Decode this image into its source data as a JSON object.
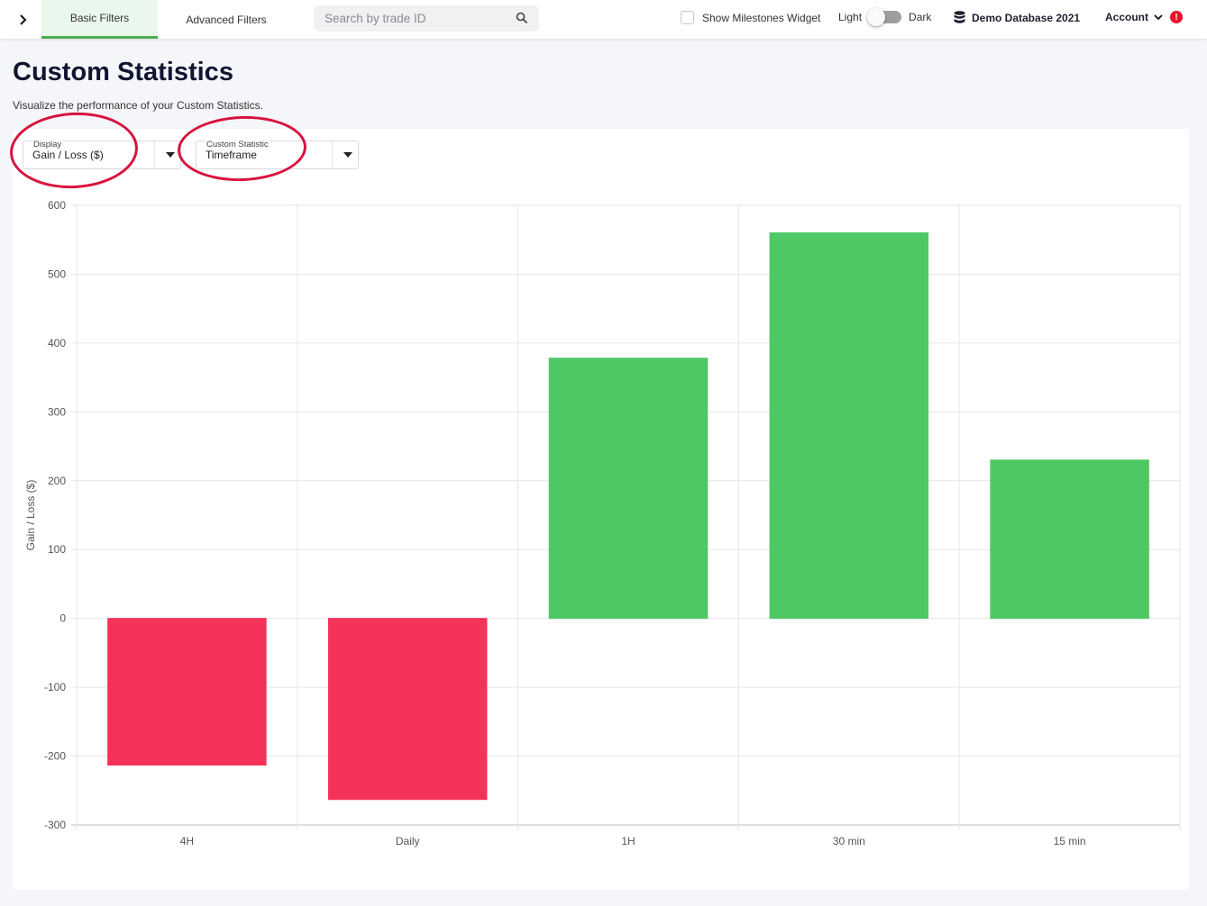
{
  "topbar": {
    "tabs": [
      {
        "label": "Basic Filters",
        "active": true
      },
      {
        "label": "Advanced Filters",
        "active": false
      }
    ],
    "search_placeholder": "Search by trade ID",
    "milestone_label": "Show Milestones Widget",
    "theme_light": "Light",
    "theme_dark": "Dark",
    "database": "Demo Database 2021",
    "account": "Account",
    "alert_badge": "!"
  },
  "page": {
    "title": "Custom Statistics",
    "subtitle": "Visualize the performance of your Custom Statistics."
  },
  "controls": {
    "display": {
      "label": "Display",
      "value": "Gain / Loss ($)"
    },
    "statistic": {
      "label": "Custom Statistic",
      "value": "Timeframe"
    }
  },
  "colors": {
    "positive": "#4ec865",
    "negative": "#f5325a",
    "highlight_circle": "#d8133d",
    "active_tab": "#4caf50"
  },
  "chart_data": {
    "type": "bar",
    "categories": [
      "4H",
      "Daily",
      "1H",
      "30 min",
      "15 min"
    ],
    "values": [
      -213,
      -263,
      378,
      560,
      230
    ],
    "ylabel": "Gain / Loss ($)",
    "xlabel": "",
    "ylim": [
      -300,
      600
    ],
    "yticks": [
      600,
      500,
      400,
      300,
      200,
      100,
      0,
      -100,
      -200,
      -300
    ],
    "grid": true
  }
}
